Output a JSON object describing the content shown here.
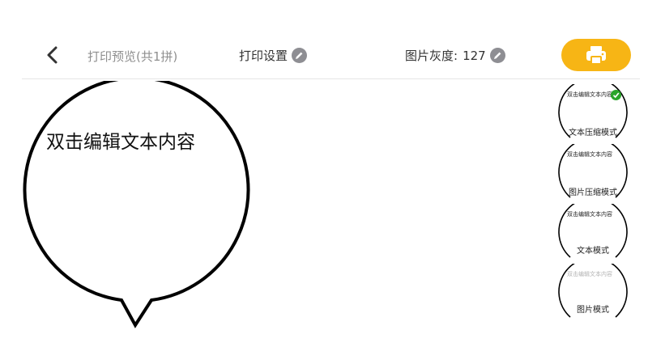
{
  "header": {
    "title": "打印预览(共1拼)",
    "print_settings_label": "打印设置",
    "grayscale_label": "图片灰度:",
    "grayscale_value": "127"
  },
  "canvas": {
    "bubble_text": "双击编辑文本内容"
  },
  "modes": [
    {
      "label": "文本压缩模式",
      "preview_text": "双击编辑文本内容",
      "selected": true
    },
    {
      "label": "图片压缩模式",
      "preview_text": "双击编辑文本内容",
      "selected": false
    },
    {
      "label": "文本模式",
      "preview_text": "双击编辑文本内容",
      "selected": false
    },
    {
      "label": "图片模式",
      "preview_text": "双击编辑文本内容",
      "selected": false
    }
  ],
  "colors": {
    "accent": "#f7b515",
    "check": "#2aa52a",
    "text": "#333333",
    "muted": "#8f8f8f"
  },
  "icons": [
    "back-arrow-icon",
    "pencil-icon",
    "printer-icon",
    "checkmark-icon"
  ]
}
